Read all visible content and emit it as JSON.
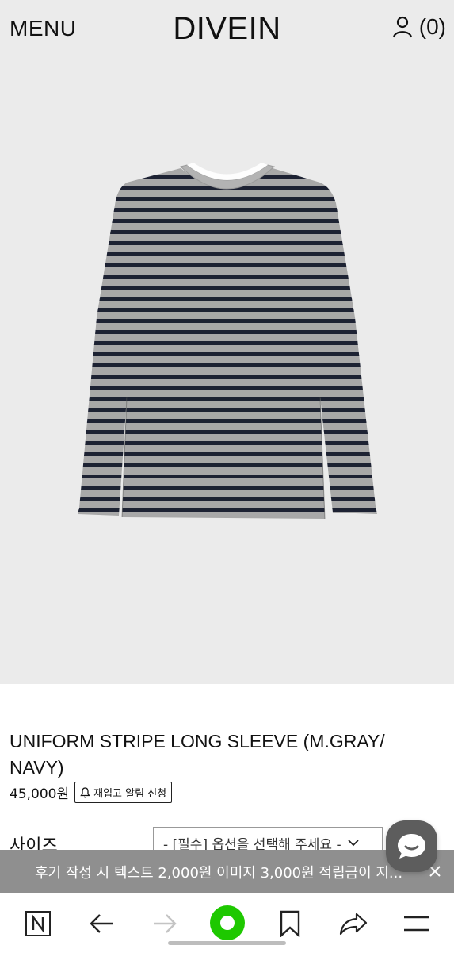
{
  "header": {
    "menu_label": "MENU",
    "logo": "DIVEIN",
    "cart_count": "(0)",
    "account_icon": "user-icon"
  },
  "product": {
    "image_alt": "striped long sleeve t-shirt",
    "title": "UNIFORM STRIPE LONG SLEEVE (M.GRAY/ NAVY)",
    "price": "45,000원",
    "restock_label": "재입고 알림 신청",
    "restock_icon": "bell-icon",
    "size_label": "사이즈",
    "size_select_placeholder": "- [필수] 옵션을 선택해 주세요 -"
  },
  "toast": {
    "message": "후기 작성 시 텍스트 2,000원 이미지 3,000원 적립금이 지...",
    "close_icon": "close-icon"
  },
  "chat": {
    "icon": "chat-bubble-icon"
  },
  "browser_nav": {
    "items": [
      "naver-home-icon",
      "back-arrow-icon",
      "forward-arrow-icon",
      "green-dot-icon",
      "bookmark-icon",
      "share-icon",
      "hamburger-menu-icon"
    ],
    "accent_color": "#1ec800"
  },
  "colors": {
    "hero_bg": "#ebebeb",
    "stripe_dark": "#1d2233",
    "stripe_light": "#a7a7a7",
    "toast_bg": "#8f8f8f"
  }
}
